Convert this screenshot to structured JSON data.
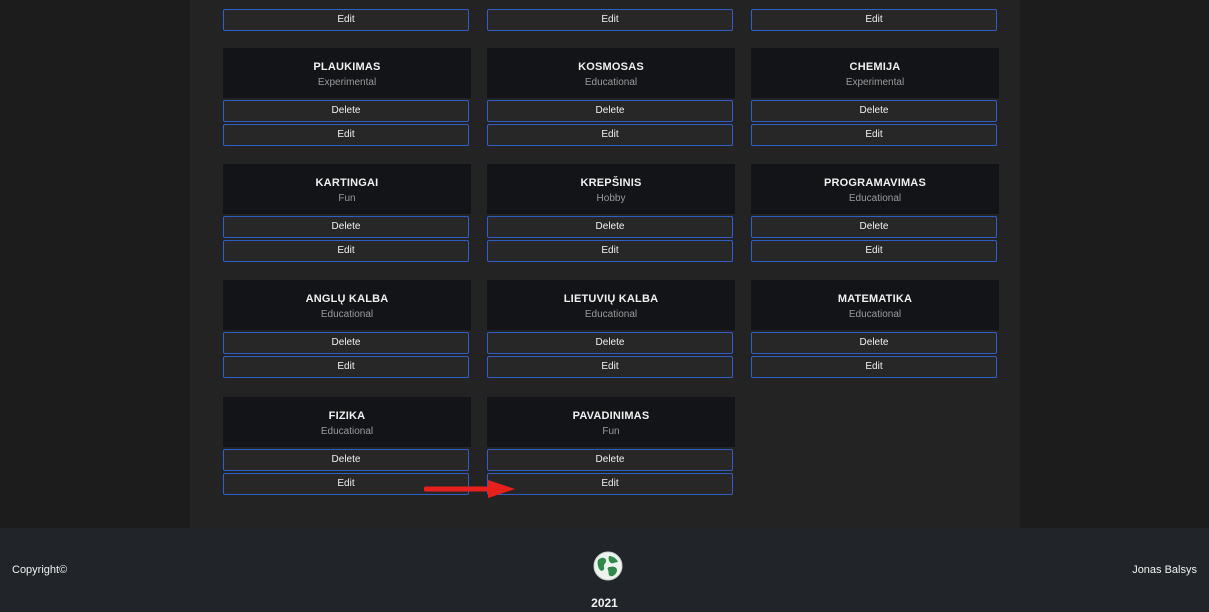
{
  "top_edit_row": [
    "Edit",
    "Edit",
    "Edit"
  ],
  "cards": [
    {
      "title": "PLAUKIMAS",
      "category": "Experimental",
      "delete_label": "Delete",
      "edit_label": "Edit"
    },
    {
      "title": "KOSMOSAS",
      "category": "Educational",
      "delete_label": "Delete",
      "edit_label": "Edit"
    },
    {
      "title": "CHEMIJA",
      "category": "Experimental",
      "delete_label": "Delete",
      "edit_label": "Edit"
    },
    {
      "title": "KARTINGAI",
      "category": "Fun",
      "delete_label": "Delete",
      "edit_label": "Edit"
    },
    {
      "title": "KREPŠINIS",
      "category": "Hobby",
      "delete_label": "Delete",
      "edit_label": "Edit"
    },
    {
      "title": "PROGRAMAVIMAS",
      "category": "Educational",
      "delete_label": "Delete",
      "edit_label": "Edit"
    },
    {
      "title": "ANGLŲ KALBA",
      "category": "Educational",
      "delete_label": "Delete",
      "edit_label": "Edit"
    },
    {
      "title": "LIETUVIŲ KALBA",
      "category": "Educational",
      "delete_label": "Delete",
      "edit_label": "Edit"
    },
    {
      "title": "MATEMATIKA",
      "category": "Educational",
      "delete_label": "Delete",
      "edit_label": "Edit"
    },
    {
      "title": "FIZIKA",
      "category": "Educational",
      "delete_label": "Delete",
      "edit_label": "Edit"
    },
    {
      "title": "PAVADINIMAS",
      "category": "Fun",
      "delete_label": "Delete",
      "edit_label": "Edit"
    }
  ],
  "footer": {
    "copyright": "Copyright©",
    "year": "2021",
    "author": "Jonas Balsys",
    "logo_icon": "globe-icon"
  },
  "annotation": {
    "arrow_icon": "red-arrow-icon",
    "arrow_color": "#e8201c"
  },
  "colors": {
    "button_border": "#2f5fc4",
    "card_header_bg": "#121417",
    "footer_bg": "#212529"
  }
}
